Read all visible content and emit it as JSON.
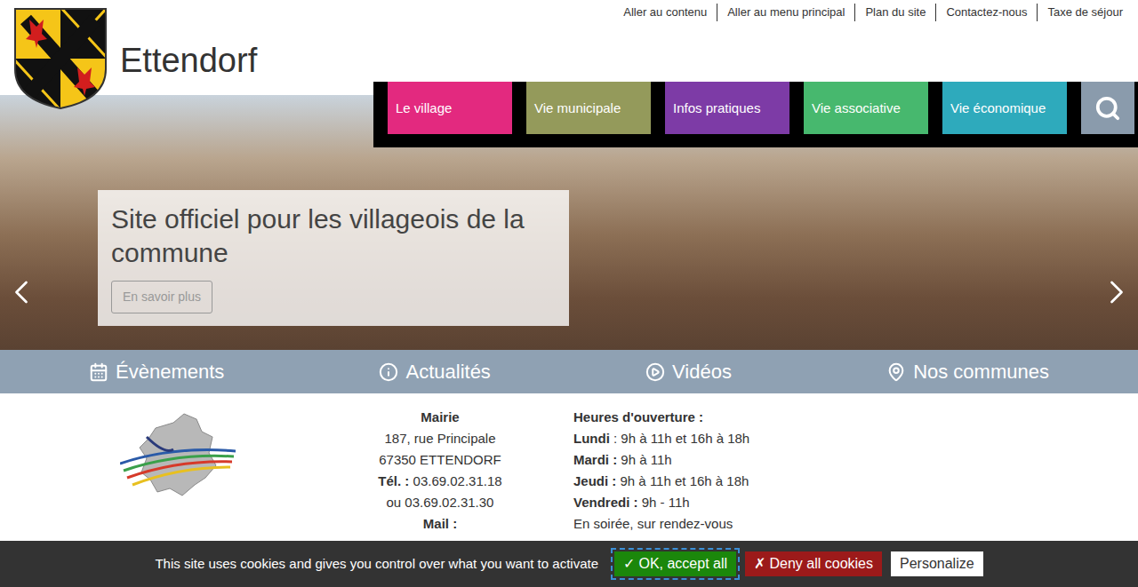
{
  "site": {
    "title": "Ettendorf"
  },
  "top_links": [
    "Aller au contenu",
    "Aller au menu principal",
    "Plan du site",
    "Contactez-nous",
    "Taxe de séjour"
  ],
  "nav": [
    {
      "label": "Le village",
      "color": "#e3297f"
    },
    {
      "label": "Vie municipale",
      "color": "#949a5b"
    },
    {
      "label": "Infos pratiques",
      "color": "#7d3ba6"
    },
    {
      "label": "Vie associative",
      "color": "#47b86e"
    },
    {
      "label": "Vie économique",
      "color": "#2eaabc"
    }
  ],
  "hero": {
    "heading": "Site officiel pour les villageois de la commune",
    "button": "En savoir plus"
  },
  "quick_links": [
    "Évènements",
    "Actualités",
    "Vidéos",
    "Nos communes"
  ],
  "mairie": {
    "title": "Mairie",
    "lines": [
      "187, rue Principale",
      "67350 ETTENDORF"
    ],
    "phone_label": "Tél. :",
    "phone": "03.69.02.31.18",
    "phone_alt": "ou 03.69.02.31.30",
    "mail_label": "Mail :"
  },
  "hours": {
    "title": "Heures d'ouverture :",
    "days": [
      {
        "day": "Lundi",
        "hours": ": 9h à 11h et 16h à 18h"
      },
      {
        "day": "Mardi :",
        "hours": "9h à 11h"
      },
      {
        "day": "Jeudi :",
        "hours": " 9h à 11h et 16h à 18h"
      },
      {
        "day": "Vendredi :",
        "hours": "9h - 11h"
      }
    ],
    "note": "En soirée, sur rendez-vous"
  },
  "cookies": {
    "text": "This site uses cookies and gives you control over what you want to activate",
    "buttons": [
      {
        "label": "✓ OK, accept all",
        "kind": "accept"
      },
      {
        "label": "✗ Deny all cookies",
        "kind": "deny"
      },
      {
        "label": "Personalize",
        "kind": "personalize"
      }
    ]
  }
}
